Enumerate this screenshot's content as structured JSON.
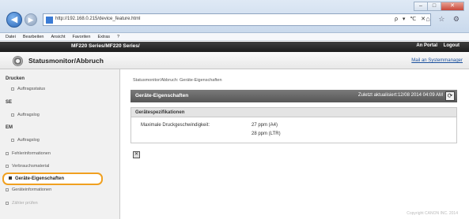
{
  "browser": {
    "url": "http://192.168.0.215/device_feature.html",
    "menu": [
      "Datei",
      "Bearbeiten",
      "Ansicht",
      "Favoriten",
      "Extras",
      "?"
    ],
    "tool_icons": "⌂ ☆ ⚙",
    "address_tools": "ρ ▾ ℃ ✕"
  },
  "header": {
    "printer_name": "MF220 Series/MF220 Series/",
    "link_portal": "An Portal",
    "link_logout": "Logout",
    "page_title": "Statusmonitor/Abbruch",
    "link_sysmgr": "Mail an Systemmanager"
  },
  "sidebar": {
    "groups": {
      "drucken": "Drucken",
      "se": "SE",
      "em": "EM"
    },
    "items": {
      "auftragsstatus": "Auftragsstatus",
      "auftragslog_se": "Auftragslog",
      "auftragslog_em": "Auftragslog",
      "fehlerinfo": "Fehlerinformationen",
      "verbrauchsmaterial": "Verbrauchsmaterial",
      "geraete_eigenschaften": "Geräte-Eigenschaften",
      "geraeteinfo": "Geräteinformationen",
      "zaehler": "Zähler prüfen"
    }
  },
  "main": {
    "breadcrumb": "Statusmonitor/Abbruch: Geräte-Eigenschaften",
    "section_title": "Geräte-Eigenschaften",
    "updated": "Zuletzt aktualisiert:12/08 2014 04:09 AM",
    "spec_heading": "Gerätespezifikationen",
    "spec_label": "Maximale Druckgeschwindigkeit:",
    "spec_value_a4": "27 ppm (A4)",
    "spec_value_ltr": "28 ppm (LTR)"
  },
  "footer": {
    "copyright": "Copyright CANON INC. 2014"
  }
}
